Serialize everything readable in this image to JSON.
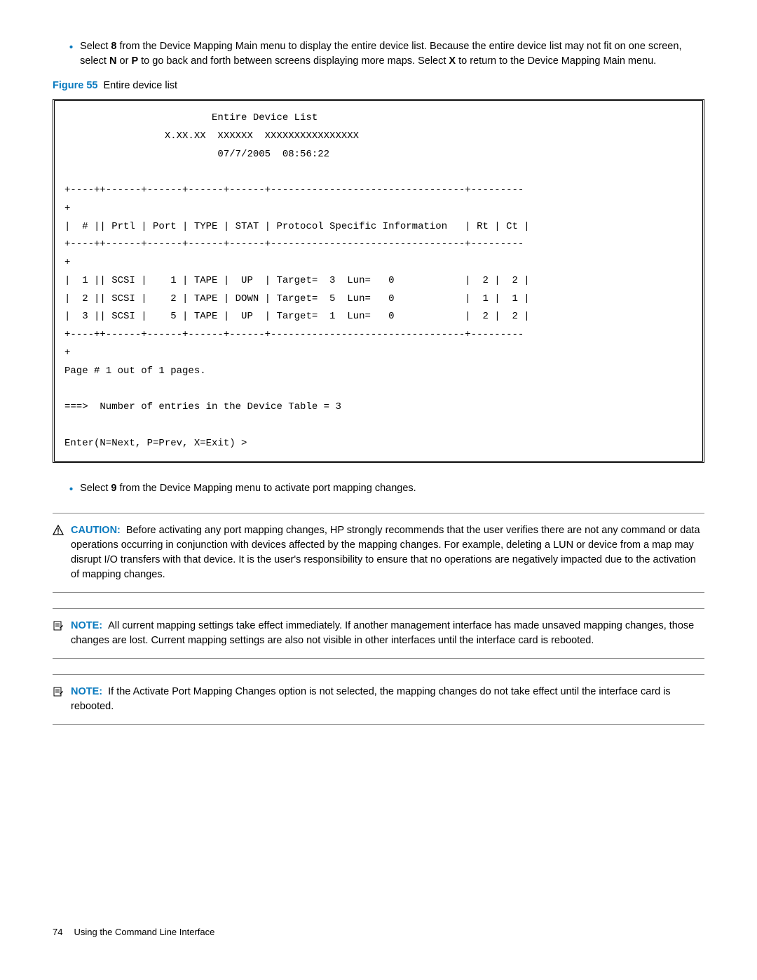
{
  "bullet1_pre": "Select ",
  "bullet1_b": "8",
  "bullet1_mid": " from the Device Mapping Main menu to display the entire device list. Because the entire device list may not fit on one screen, select ",
  "bullet1_n": "N",
  "bullet1_or": " or ",
  "bullet1_p": "P",
  "bullet1_mid2": " to go back and forth between screens displaying more maps. Select ",
  "bullet1_x": "X",
  "bullet1_end": " to return to the Device Mapping Main menu.",
  "figure_num": "Figure 55",
  "figure_caption": "Entire device list",
  "codeblock": "                         Entire Device List\n                 X.XX.XX  XXXXXX  XXXXXXXXXXXXXXXX\n                          07/7/2005  08:56:22\n\n+----++------+------+------+------+---------------------------------+---------\n+\n|  # || Prtl | Port | TYPE | STAT | Protocol Specific Information   | Rt | Ct |\n+----++------+------+------+------+---------------------------------+---------\n+\n|  1 || SCSI |    1 | TAPE |  UP  | Target=  3  Lun=   0            |  2 |  2 |\n|  2 || SCSI |    2 | TAPE | DOWN | Target=  5  Lun=   0            |  1 |  1 |\n|  3 || SCSI |    5 | TAPE |  UP  | Target=  1  Lun=   0            |  2 |  2 |\n+----++------+------+------+------+---------------------------------+---------\n+\nPage # 1 out of 1 pages.\n\n===>  Number of entries in the Device Table = 3\n\nEnter(N=Next, P=Prev, X=Exit) >",
  "bullet2_pre": "Select ",
  "bullet2_b": "9",
  "bullet2_end": " from the Device Mapping menu to activate port mapping changes.",
  "caution_label": "CAUTION:",
  "caution_body": "Before activating any port mapping changes, HP strongly recommends that the user verifies there are not any command or data operations occurring in conjunction with devices affected by the mapping changes. For example, deleting a LUN or device from a map may disrupt I/O transfers with that device. It is the user's responsibility to ensure that no operations are negatively impacted due to the activation of mapping changes.",
  "note1_label": "NOTE:",
  "note1_body": "All current mapping settings take effect immediately. If another management interface has made unsaved mapping changes, those changes are lost. Current mapping settings are also not visible in other interfaces until the interface card is rebooted.",
  "note2_label": "NOTE:",
  "note2_body": "If the Activate Port Mapping Changes option is not selected, the mapping changes do not take effect until the interface card is rebooted.",
  "page_number": "74",
  "page_section": "Using the Command Line Interface"
}
